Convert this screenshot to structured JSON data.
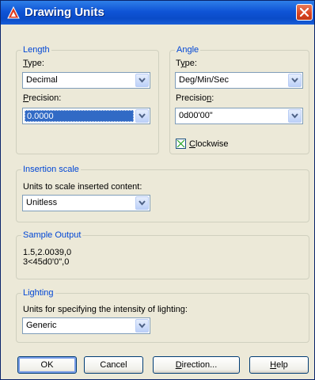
{
  "window": {
    "title": "Drawing Units",
    "close_icon": "close-icon"
  },
  "length": {
    "group_label": "Length",
    "type_label_pre": "",
    "type_label_u": "T",
    "type_label_post": "ype:",
    "type_value": "Decimal",
    "precision_label_pre": "",
    "precision_label_u": "P",
    "precision_label_post": "recision:",
    "precision_value": "0.0000"
  },
  "angle": {
    "group_label": "Angle",
    "type_label_pre": "T",
    "type_label_u": "y",
    "type_label_post": "pe:",
    "type_value": "Deg/Min/Sec",
    "precision_label_pre": "Precisio",
    "precision_label_u": "n",
    "precision_label_post": ":",
    "precision_value": "0d00'00\"",
    "clockwise_label_pre": "",
    "clockwise_label_u": "C",
    "clockwise_label_post": "lockwise",
    "clockwise_checked": true
  },
  "insertion": {
    "group_label": "Insertion scale",
    "units_label": "Units to scale inserted content:",
    "units_value": "Unitless"
  },
  "sample": {
    "group_label": "Sample Output",
    "line1": "1.5,2.0039,0",
    "line2": "3<45d0'0\",0"
  },
  "lighting": {
    "group_label": "Lighting",
    "units_label": "Units for specifying the intensity of lighting:",
    "units_value": "Generic"
  },
  "buttons": {
    "ok": "OK",
    "cancel": "Cancel",
    "direction_pre": "",
    "direction_u": "D",
    "direction_post": "irection...",
    "help_pre": "",
    "help_u": "H",
    "help_post": "elp"
  },
  "colors": {
    "titlebar": "#0a4bc8",
    "group_label": "#0046d5",
    "selection": "#316ac5",
    "dialog_bg": "#ece9d8"
  }
}
